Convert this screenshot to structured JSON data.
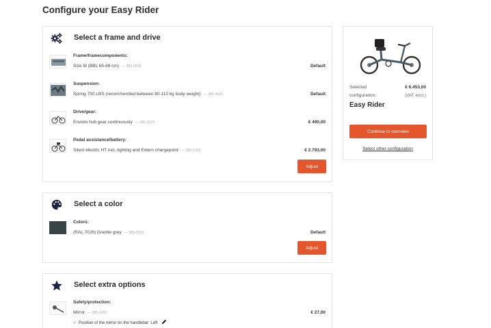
{
  "page": {
    "title": "Configure your Easy Rider"
  },
  "frame_section": {
    "title": "Select a frame and drive",
    "icon": "gears-icon",
    "rows": [
      {
        "label": "Frame/framecomponents:",
        "value": "Size M (BBL 65-88 cm)",
        "code": "—  385-0003",
        "price": "Default"
      },
      {
        "label": "Suspension:",
        "value": "Spring 750 LBS (recommended between 80-110 kg body weight)",
        "code": "—  385-4615",
        "price": "Default"
      },
      {
        "label": "Drive/gear:",
        "value": "Enviolo hub gear continuously",
        "code": "—  385-1076",
        "price": "€ 490,00"
      },
      {
        "label": "Pedal assistance/battery:",
        "value": "Silent electric HT incl. lighting and Extern chargepoint",
        "code": "—  385-2160",
        "price": "€ 2.793,00"
      }
    ],
    "adjust_label": "Adjust"
  },
  "color_section": {
    "title": "Select a color",
    "icon": "palette-icon",
    "rows": [
      {
        "label": "Colors:",
        "value": "(RAL 7026) Granite grey",
        "code": "—  385-3203",
        "price": "Default",
        "swatch": "#3a4346"
      }
    ],
    "adjust_label": "Adjust"
  },
  "extras_section": {
    "title": "Select extra options",
    "icon": "star-icon",
    "rows": [
      {
        "label": "Safety/protection:",
        "value": "Mirror",
        "code": "—  385-4200",
        "price": "€ 27,00"
      }
    ],
    "note": "Position of the mirror on the handlebar: Left"
  },
  "summary": {
    "selected_label": "Selected",
    "selected_value": "€ 6.453,00",
    "config_label": "configuration:",
    "config_value": "(VAT excl.)",
    "name": "Easy Rider",
    "continue_label": "Continue to overview",
    "other_link": "Select other configuration"
  },
  "colors": {
    "accent": "#e4572e",
    "border": "#e3e3e3",
    "icon": "#1c2340"
  }
}
